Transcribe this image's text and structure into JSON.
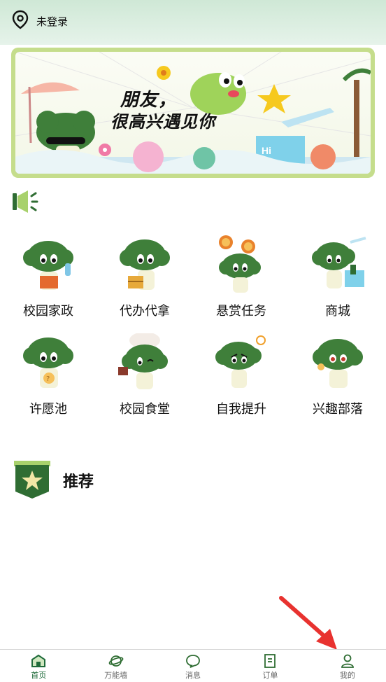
{
  "header": {
    "location_icon": "location-pin-icon",
    "login_status": "未登录"
  },
  "banner": {
    "line1": "朋友，",
    "line2": "很高兴遇见你"
  },
  "announcement": {
    "icon": "megaphone-icon"
  },
  "services": [
    {
      "label": "校园家政",
      "icon": "mascot-housekeeping-icon"
    },
    {
      "label": "代办代拿",
      "icon": "mascot-errand-icon"
    },
    {
      "label": "悬赏任务",
      "icon": "mascot-bounty-icon"
    },
    {
      "label": "商城",
      "icon": "mascot-mall-icon"
    },
    {
      "label": "许愿池",
      "icon": "mascot-wish-icon"
    },
    {
      "label": "校园食堂",
      "icon": "mascot-canteen-icon"
    },
    {
      "label": "自我提升",
      "icon": "mascot-selfimprove-icon"
    },
    {
      "label": "兴趣部落",
      "icon": "mascot-interest-icon"
    }
  ],
  "recommend": {
    "title": "推荐",
    "icon": "star-badge-icon"
  },
  "tabbar": {
    "active": "home",
    "tabs": [
      {
        "label": "首页",
        "icon": "home-icon"
      },
      {
        "label": "万能墙",
        "icon": "planet-icon"
      },
      {
        "label": "消息",
        "icon": "chat-bubble-icon"
      },
      {
        "label": "订单",
        "icon": "order-list-icon"
      },
      {
        "label": "我的",
        "icon": "user-icon"
      }
    ]
  },
  "colors": {
    "brand_green": "#2f6d33",
    "mascot_green": "#3f7f3a",
    "header_bg": "#cfe8d6",
    "banner_border": "#c5dd8c",
    "active_tab": "#1f6b3a",
    "annotation_arrow": "#e8322f"
  }
}
